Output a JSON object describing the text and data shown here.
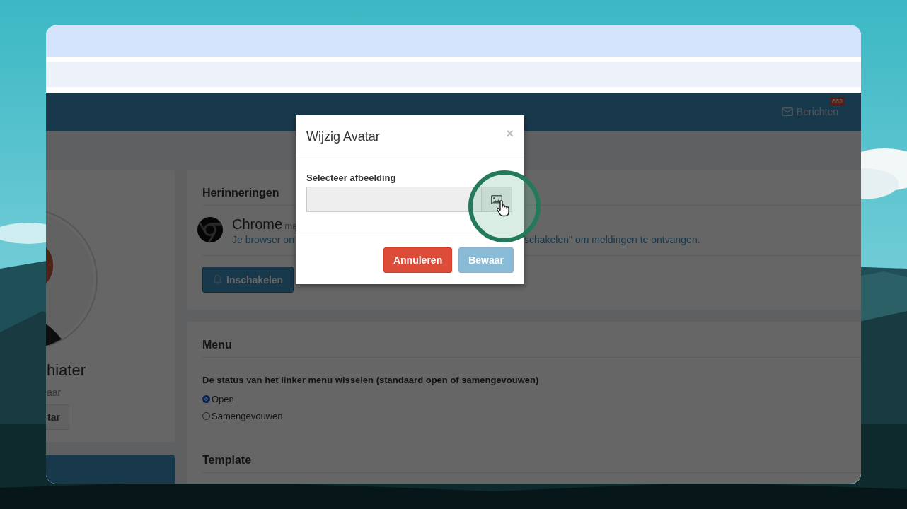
{
  "header": {
    "messages_label": "Berichten",
    "messages_badge": "663"
  },
  "profile": {
    "name": "hiater",
    "role": "aar",
    "button": "tar"
  },
  "reminders": {
    "title": "Herinneringen",
    "browser": "Chrome",
    "browser_note": "ma",
    "message_parts": [
      "Je browser on",
      "schakelen\" om meldingen te ontvangen."
    ],
    "button": "Inschakelen"
  },
  "menu": {
    "title": "Menu",
    "question": "De status van het linker menu wisselen (standaard open of samengevouwen)",
    "options": [
      {
        "label": "Open",
        "selected": true
      },
      {
        "label": "Samengevouwen",
        "selected": false
      }
    ]
  },
  "template": {
    "title": "Template"
  },
  "modal": {
    "title": "Wijzig Avatar",
    "close": "×",
    "field_label": "Selecteer afbeelding",
    "buttons": [
      {
        "label": "Annuleren",
        "kind": "danger",
        "disabled": false
      },
      {
        "label": "Bewaar",
        "kind": "primary",
        "disabled": true
      }
    ]
  }
}
